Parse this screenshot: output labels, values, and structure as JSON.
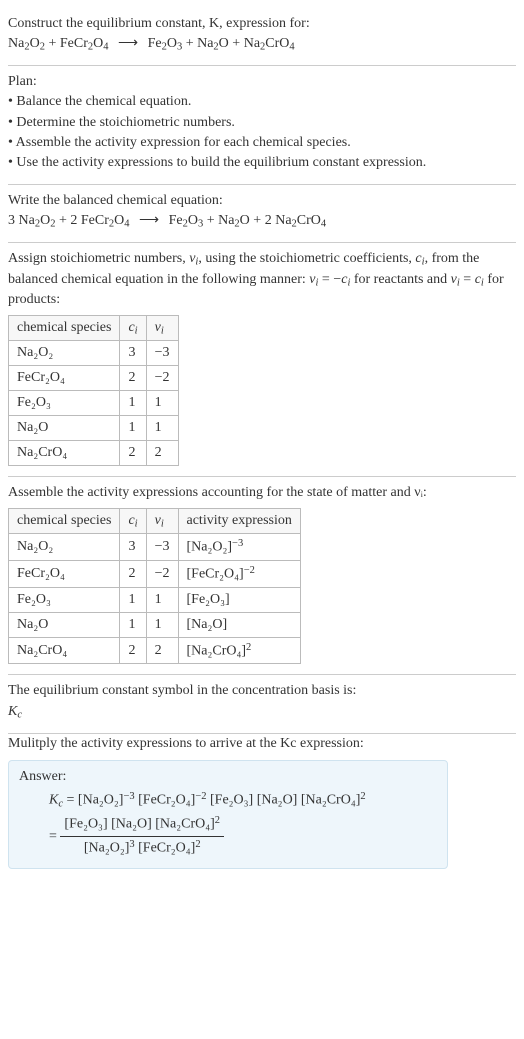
{
  "section1": {
    "l1": "Construct the equilibrium constant, K, expression for:",
    "eq_lhs1": "Na",
    "eq_lhs1_sub": "2",
    "eq_lhs2": "O",
    "eq_lhs2_sub": "2",
    "plus1": " + ",
    "eq_lhs3": "FeCr",
    "eq_lhs3_sub": "2",
    "eq_lhs4": "O",
    "eq_lhs4_sub": "4",
    "arrow": "⟶",
    "eq_rhs1": "Fe",
    "eq_rhs1_sub": "2",
    "eq_rhs2": "O",
    "eq_rhs2_sub": "3",
    "plus2": " + ",
    "eq_rhs3": "Na",
    "eq_rhs3_sub": "2",
    "eq_rhs4": "O",
    "plus3": " + ",
    "eq_rhs5": "Na",
    "eq_rhs5_sub": "2",
    "eq_rhs6": "CrO",
    "eq_rhs6_sub": "4"
  },
  "section2": {
    "title": "Plan:",
    "b1": "• Balance the chemical equation.",
    "b2": "• Determine the stoichiometric numbers.",
    "b3": "• Assemble the activity expression for each chemical species.",
    "b4": "• Use the activity expressions to build the equilibrium constant expression."
  },
  "section3": {
    "l1": "Write the balanced chemical equation:",
    "c1": "3 ",
    "c2": "2 ",
    "c3": "2 "
  },
  "section4": {
    "l1a": "Assign stoichiometric numbers, ",
    "nu": "ν",
    "i": "i",
    "l1b": ", using the stoichiometric coefficients, ",
    "c": "c",
    "l1c": ", from the balanced chemical equation in the following manner: ",
    "rel1": " = −",
    "rel2": " for reactants and ",
    "rel3": " = ",
    "rel4": " for products:",
    "hdr_species": "chemical species",
    "hdr_ci": "cᵢ",
    "hdr_vi": "νᵢ",
    "rows": [
      {
        "species": "Na₂O₂",
        "ci": "3",
        "vi": "−3"
      },
      {
        "species": "FeCr₂O₄",
        "ci": "2",
        "vi": "−2"
      },
      {
        "species": "Fe₂O₃",
        "ci": "1",
        "vi": "1"
      },
      {
        "species": "Na₂O",
        "ci": "1",
        "vi": "1"
      },
      {
        "species": "Na₂CrO₄",
        "ci": "2",
        "vi": "2"
      }
    ]
  },
  "section5": {
    "l1": "Assemble the activity expressions accounting for the state of matter and νᵢ:",
    "hdr_species": "chemical species",
    "hdr_ci": "cᵢ",
    "hdr_vi": "νᵢ",
    "hdr_act": "activity expression",
    "rows": [
      {
        "species": "Na₂O₂",
        "ci": "3",
        "vi": "−3",
        "act_base": "[Na₂O₂]",
        "act_exp": "−3"
      },
      {
        "species": "FeCr₂O₄",
        "ci": "2",
        "vi": "−2",
        "act_base": "[FeCr₂O₄]",
        "act_exp": "−2"
      },
      {
        "species": "Fe₂O₃",
        "ci": "1",
        "vi": "1",
        "act_base": "[Fe₂O₃]",
        "act_exp": ""
      },
      {
        "species": "Na₂O",
        "ci": "1",
        "vi": "1",
        "act_base": "[Na₂O]",
        "act_exp": ""
      },
      {
        "species": "Na₂CrO₄",
        "ci": "2",
        "vi": "2",
        "act_base": "[Na₂CrO₄]",
        "act_exp": "2"
      }
    ]
  },
  "section6": {
    "l1": "The equilibrium constant symbol in the concentration basis is:",
    "sym": "K",
    "sub": "c"
  },
  "section7": {
    "l1": "Mulitply the activity expressions to arrive at the Kc expression:",
    "answer": "Answer:",
    "kc": "K",
    "kcsub": "c",
    "eq": " = ",
    "t1": "[Na₂O₂]",
    "e1": "−3",
    "t2": " [FeCr₂O₄]",
    "e2": "−2",
    "t3": " [Fe₂O₃] [Na₂O] [Na₂CrO₄]",
    "e3": "2",
    "eq2": "= ",
    "num_top": "[Fe₂O₃] [Na₂O] [Na₂CrO₄]",
    "num_top_exp": "2",
    "den1": "[Na₂O₂]",
    "den1_exp": "3",
    "den2": " [FeCr₂O₄]",
    "den2_exp": "2"
  },
  "chart_data": {
    "type": "table",
    "title": "Stoichiometric numbers and activity expressions",
    "tables": [
      {
        "columns": [
          "chemical species",
          "cᵢ",
          "νᵢ"
        ],
        "rows": [
          [
            "Na₂O₂",
            3,
            -3
          ],
          [
            "FeCr₂O₄",
            2,
            -2
          ],
          [
            "Fe₂O₃",
            1,
            1
          ],
          [
            "Na₂O",
            1,
            1
          ],
          [
            "Na₂CrO₄",
            2,
            2
          ]
        ]
      },
      {
        "columns": [
          "chemical species",
          "cᵢ",
          "νᵢ",
          "activity expression"
        ],
        "rows": [
          [
            "Na₂O₂",
            3,
            -3,
            "[Na₂O₂]^-3"
          ],
          [
            "FeCr₂O₄",
            2,
            -2,
            "[FeCr₂O₄]^-2"
          ],
          [
            "Fe₂O₃",
            1,
            1,
            "[Fe₂O₃]"
          ],
          [
            "Na₂O",
            1,
            1,
            "[Na₂O]"
          ],
          [
            "Na₂CrO₄",
            2,
            2,
            "[Na₂CrO₄]^2"
          ]
        ]
      }
    ]
  }
}
